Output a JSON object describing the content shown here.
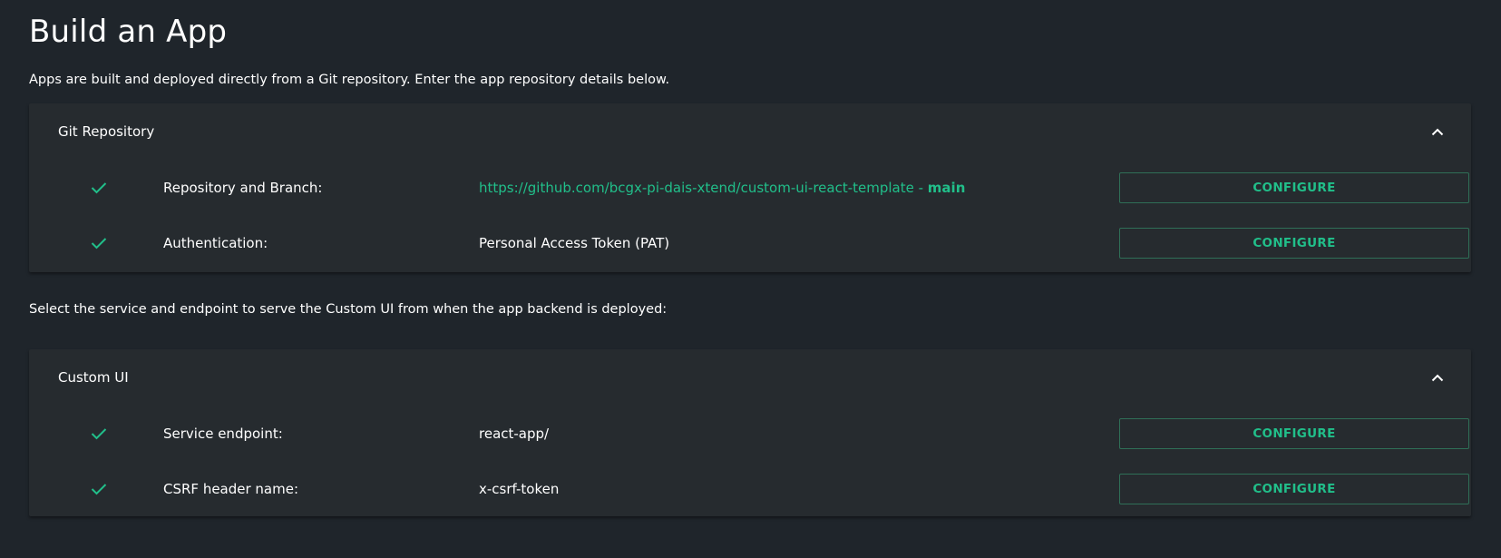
{
  "page": {
    "title": "Build an App",
    "intro": "Apps are built and deployed directly from a Git repository. Enter the app repository details below.",
    "custom_ui_intro": "Select the service and endpoint to serve the Custom UI from when the app backend is deployed:"
  },
  "git_panel": {
    "title": "Git Repository",
    "collapse_icon": "chevron-up-icon",
    "rows": [
      {
        "label": "Repository and Branch:",
        "value_url": "https://github.com/bcgx-pi-dais-xtend/custom-ui-react-template",
        "value_separator": " - ",
        "value_branch": "main",
        "status_icon": "check-icon",
        "button_label": "CONFIGURE"
      },
      {
        "label": "Authentication:",
        "value": "Personal Access Token (PAT)",
        "status_icon": "check-icon",
        "button_label": "CONFIGURE"
      }
    ]
  },
  "custom_ui_panel": {
    "title": "Custom UI",
    "collapse_icon": "chevron-up-icon",
    "rows": [
      {
        "label": "Service endpoint:",
        "value": "react-app/",
        "status_icon": "check-icon",
        "button_label": "CONFIGURE"
      },
      {
        "label": "CSRF header name:",
        "value": "x-csrf-token",
        "status_icon": "check-icon",
        "button_label": "CONFIGURE"
      }
    ]
  },
  "colors": {
    "background": "#1f252b",
    "panel": "#262b2f",
    "accent": "#21bf8a",
    "button_border": "#2f6f57"
  }
}
